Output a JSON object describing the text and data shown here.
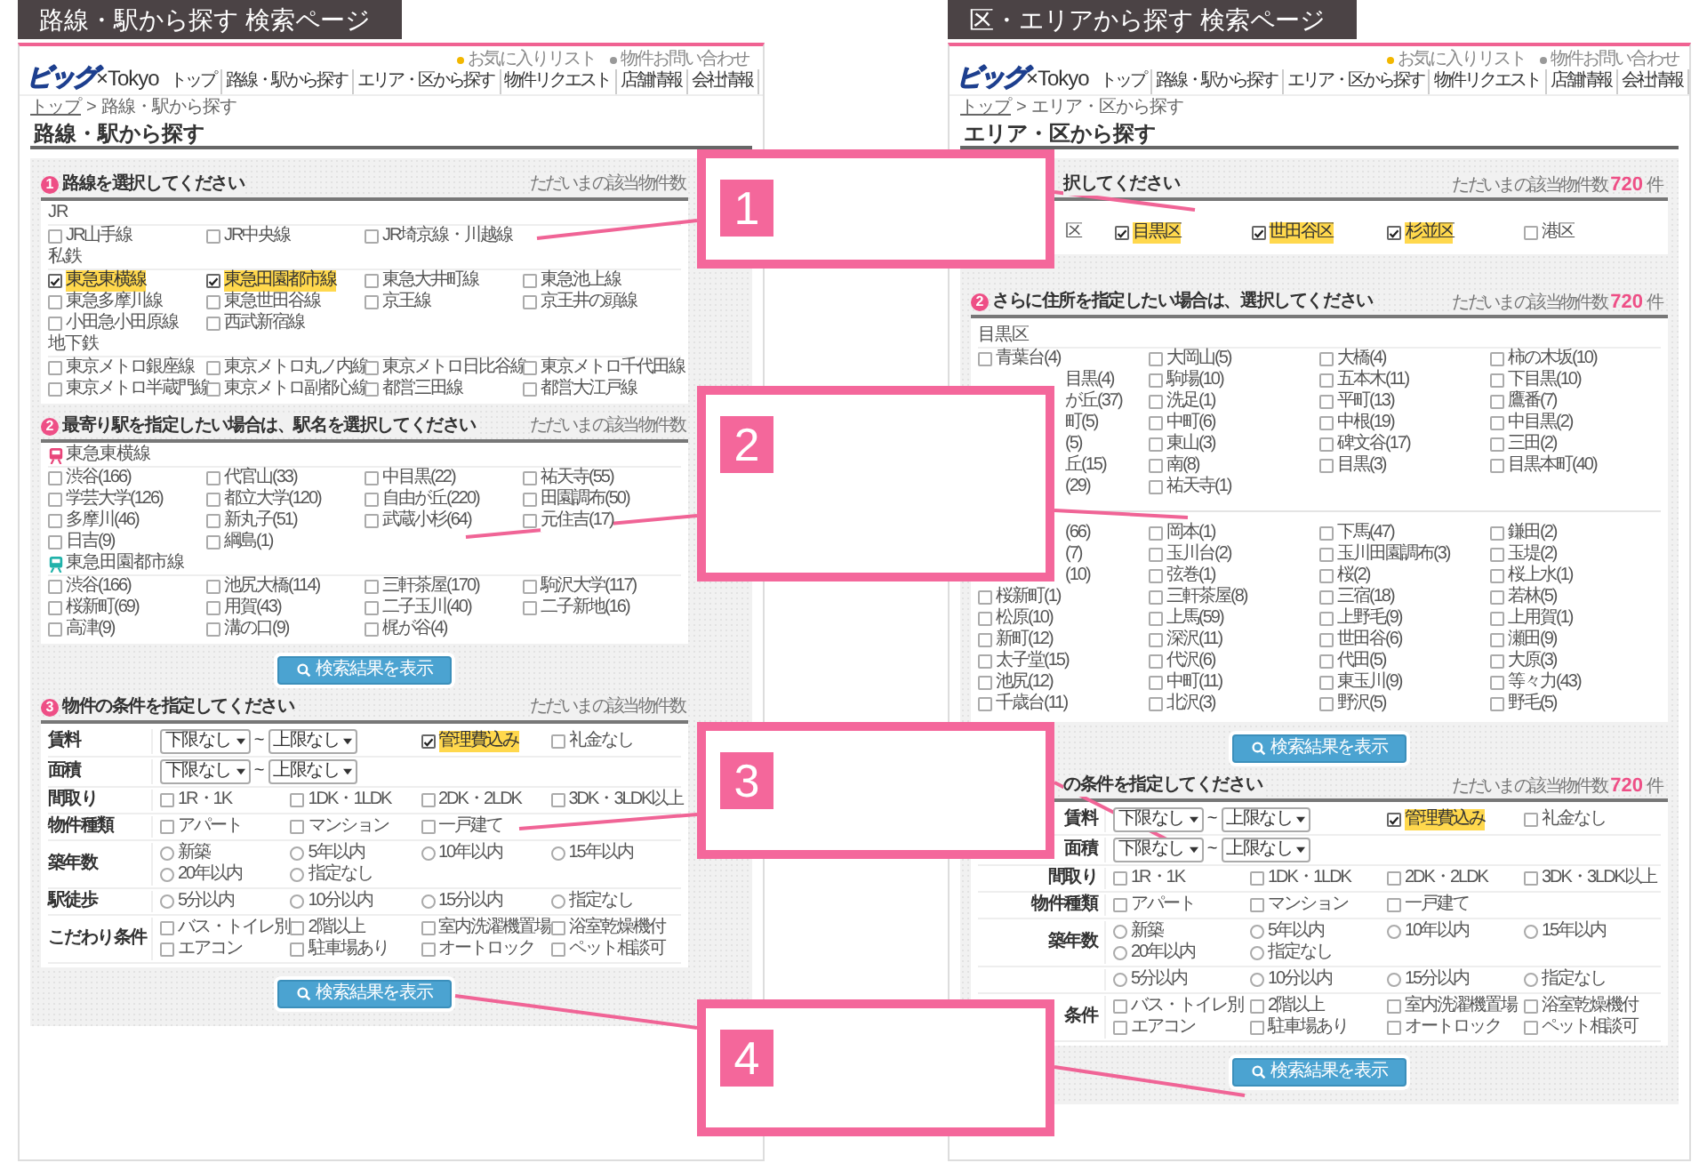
{
  "panels": [
    {
      "tab_title": "路線・駅から探す 検索ページ",
      "logo": {
        "mark": "ビッグ",
        "text": "×Tokyo"
      },
      "top_links": [
        "お気に入りリスト",
        "物件お問い合わせ"
      ],
      "nav": [
        "トップ",
        "路線・駅から探す",
        "エリア・区から探す",
        "物件リクエスト",
        "店舗情報",
        "会社情報"
      ],
      "breadcrumb": {
        "items": [
          "トップ",
          "路線・駅から探す"
        ],
        "separator": ">"
      },
      "heading": "路線・駅から探す",
      "sections": [
        {
          "kind": "checklist",
          "number": "1",
          "title": "路線を選択してください",
          "count_label": "ただいまの該当物件数",
          "groups": [
            {
              "label": "JR",
              "items": [
                {
                  "label": "JR山手線",
                  "checked": false
                },
                {
                  "label": "JR中央線",
                  "checked": false
                },
                {
                  "label": "JR埼京線・川越線",
                  "checked": false
                }
              ]
            },
            {
              "label": "私鉄",
              "items": [
                {
                  "label": "東急東横線",
                  "checked": true
                },
                {
                  "label": "東急田園都市線",
                  "checked": true
                },
                {
                  "label": "東急大井町線",
                  "checked": false
                },
                {
                  "label": "東急池上線",
                  "checked": false
                },
                {
                  "label": "東急多摩川線",
                  "checked": false
                },
                {
                  "label": "東急世田谷線",
                  "checked": false
                },
                {
                  "label": "京王線",
                  "checked": false
                },
                {
                  "label": "京王井の頭線",
                  "checked": false
                },
                {
                  "label": "小田急小田原線",
                  "checked": false
                },
                {
                  "label": "西武新宿線",
                  "checked": false
                }
              ]
            },
            {
              "label": "地下鉄",
              "items": [
                {
                  "label": "東京メトロ銀座線",
                  "checked": false
                },
                {
                  "label": "東京メトロ丸ノ内線",
                  "checked": false
                },
                {
                  "label": "東京メトロ日比谷線",
                  "checked": false
                },
                {
                  "label": "東京メトロ千代田線",
                  "checked": false
                },
                {
                  "label": "東京メトロ半蔵門線",
                  "checked": false
                },
                {
                  "label": "東京メトロ副都心線",
                  "checked": false
                },
                {
                  "label": "都営三田線",
                  "checked": false
                },
                {
                  "label": "都営大江戸線",
                  "checked": false
                }
              ]
            }
          ]
        },
        {
          "kind": "checklist",
          "number": "2",
          "title": "最寄り駅を指定したい場合は、駅名を選択してください",
          "count_label": "ただいまの該当物件数",
          "groups": [
            {
              "label": "東急東横線",
              "color": "#e8457a",
              "items": [
                {
                  "label": "渋谷(166)",
                  "checked": false
                },
                {
                  "label": "代官山(33)",
                  "checked": false
                },
                {
                  "label": "中目黒(22)",
                  "checked": false
                },
                {
                  "label": "祐天寺(55)",
                  "checked": false
                },
                {
                  "label": "学芸大学(126)",
                  "checked": false
                },
                {
                  "label": "都立大学(120)",
                  "checked": false
                },
                {
                  "label": "自由が丘(220)",
                  "checked": false
                },
                {
                  "label": "田園調布(50)",
                  "checked": false
                },
                {
                  "label": "多摩川(46)",
                  "checked": false
                },
                {
                  "label": "新丸子(51)",
                  "checked": false
                },
                {
                  "label": "武蔵小杉(64)",
                  "checked": false
                },
                {
                  "label": "元住吉(17)",
                  "checked": false
                },
                {
                  "label": "日吉(9)",
                  "checked": false
                },
                {
                  "label": "綱島(1)",
                  "checked": false
                }
              ]
            },
            {
              "label": "東急田園都市線",
              "color": "#20b2aa",
              "items": [
                {
                  "label": "渋谷(166)",
                  "checked": false
                },
                {
                  "label": "池尻大橋(114)",
                  "checked": false
                },
                {
                  "label": "三軒茶屋(170)",
                  "checked": false
                },
                {
                  "label": "駒沢大学(117)",
                  "checked": false
                },
                {
                  "label": "桜新町(69)",
                  "checked": false
                },
                {
                  "label": "用賀(43)",
                  "checked": false
                },
                {
                  "label": "二子玉川(40)",
                  "checked": false
                },
                {
                  "label": "二子新地(16)",
                  "checked": false
                },
                {
                  "label": "高津(9)",
                  "checked": false
                },
                {
                  "label": "溝の口(9)",
                  "checked": false
                },
                {
                  "label": "梶が谷(4)",
                  "checked": false
                }
              ]
            }
          ],
          "button": "検索結果を表示"
        },
        {
          "kind": "conditions",
          "number": "3",
          "title": "物件の条件を指定してください",
          "count_label": "ただいまの該当物件数",
          "rows": [
            {
              "label": "賃料",
              "cells": [
                {
                  "kind": "range",
                  "colspan": 2,
                  "from": "下限なし",
                  "separator": "~",
                  "to": "上限なし"
                },
                {
                  "kind": "checkbox",
                  "label": "管理費込み",
                  "checked": true
                },
                {
                  "kind": "checkbox",
                  "label": "礼金なし",
                  "checked": false
                }
              ]
            },
            {
              "label": "面積",
              "cells": [
                {
                  "kind": "range",
                  "colspan": 2,
                  "from": "下限なし",
                  "separator": "~",
                  "to": "上限なし"
                }
              ]
            },
            {
              "label": "間取り",
              "cells": [
                {
                  "kind": "checkbox",
                  "label": "1R・1K",
                  "checked": false
                },
                {
                  "kind": "checkbox",
                  "label": "1DK・1LDK",
                  "checked": false
                },
                {
                  "kind": "checkbox",
                  "label": "2DK・2LDK",
                  "checked": false
                },
                {
                  "kind": "checkbox",
                  "label": "3DK・3LDK以上",
                  "checked": false
                }
              ]
            },
            {
              "label": "物件種類",
              "cells": [
                {
                  "kind": "checkbox",
                  "label": "アパート",
                  "checked": false
                },
                {
                  "kind": "checkbox",
                  "label": "マンション",
                  "checked": false
                },
                {
                  "kind": "checkbox",
                  "label": "一戸建て",
                  "checked": false
                }
              ]
            },
            {
              "label": "築年数",
              "cells": [
                {
                  "kind": "radio",
                  "label": "新築",
                  "selected": false
                },
                {
                  "kind": "radio",
                  "label": "5年以内",
                  "selected": false
                },
                {
                  "kind": "radio",
                  "label": "10年以内",
                  "selected": false
                },
                {
                  "kind": "radio",
                  "label": "15年以内",
                  "selected": false
                },
                {
                  "kind": "radio",
                  "label": "20年以内",
                  "selected": false
                },
                {
                  "kind": "radio",
                  "label": "指定なし",
                  "selected": false
                }
              ]
            },
            {
              "label": "駅徒歩",
              "cells": [
                {
                  "kind": "radio",
                  "label": "5分以内",
                  "selected": false
                },
                {
                  "kind": "radio",
                  "label": "10分以内",
                  "selected": false
                },
                {
                  "kind": "radio",
                  "label": "15分以内",
                  "selected": false
                },
                {
                  "kind": "radio",
                  "label": "指定なし",
                  "selected": false
                }
              ]
            },
            {
              "label": "こだわり条件",
              "cells": [
                {
                  "kind": "checkbox",
                  "label": "バス・トイレ別",
                  "checked": false
                },
                {
                  "kind": "checkbox",
                  "label": "2階以上",
                  "checked": false
                },
                {
                  "kind": "checkbox",
                  "label": "室内洗濯機置場",
                  "checked": false
                },
                {
                  "kind": "checkbox",
                  "label": "浴室乾燥機付",
                  "checked": false
                },
                {
                  "kind": "checkbox",
                  "label": "エアコン",
                  "checked": false
                },
                {
                  "kind": "checkbox",
                  "label": "駐車場あり",
                  "checked": false
                },
                {
                  "kind": "checkbox",
                  "label": "オートロック",
                  "checked": false
                },
                {
                  "kind": "checkbox",
                  "label": "ペット相談可",
                  "checked": false
                }
              ]
            }
          ],
          "button": "検索結果を表示"
        }
      ]
    },
    {
      "tab_title": "区・エリアから探す 検索ページ",
      "logo": {
        "mark": "ビッグ",
        "text": "×Tokyo"
      },
      "top_links": [
        "お気に入りリスト",
        "物件お問い合わせ"
      ],
      "nav": [
        "トップ",
        "路線・駅から探す",
        "エリア・区から探す",
        "物件リクエスト",
        "店舗情報",
        "会社情報"
      ],
      "breadcrumb": {
        "items": [
          "トップ",
          "エリア・区から探す"
        ],
        "separator": ">"
      },
      "heading": "エリア・区から探す",
      "sections": [
        {
          "kind": "checklist",
          "title": "択してください",
          "count_label": "ただいまの該当物件数",
          "count": "720",
          "count_unit": "件",
          "groups": [
            {
              "items": [
                {
                  "kind": "partial",
                  "label": "区"
                },
                {
                  "label": "目黒区",
                  "checked": true
                },
                {
                  "label": "世田谷区",
                  "checked": true
                },
                {
                  "label": "杉並区",
                  "checked": true
                },
                {
                  "label": "港区",
                  "checked": false
                }
              ]
            }
          ]
        },
        {
          "kind": "checklist",
          "number": "2",
          "title": "さらに住所を指定したい場合は、選択してください",
          "count_label": "ただいまの該当物件数",
          "count": "720",
          "count_unit": "件",
          "groups": [
            {
              "label": "目黒区",
              "items": [
                {
                  "label": "青葉台(4)",
                  "checked": false
                },
                {
                  "label": "大岡山(5)",
                  "checked": false
                },
                {
                  "label": "大橋(4)",
                  "checked": false
                },
                {
                  "label": "柿の木坂(10)",
                  "checked": false
                },
                {
                  "kind": "partial",
                  "label": "目黒(4)"
                },
                {
                  "label": "駒場(10)",
                  "checked": false
                },
                {
                  "label": "五本木(11)",
                  "checked": false
                },
                {
                  "label": "下目黒(10)",
                  "checked": false
                },
                {
                  "kind": "partial",
                  "label": "が丘(37)"
                },
                {
                  "label": "洗足(1)",
                  "checked": false
                },
                {
                  "label": "平町(13)",
                  "checked": false
                },
                {
                  "label": "鷹番(7)",
                  "checked": false
                },
                {
                  "kind": "partial",
                  "label": "町(5)"
                },
                {
                  "label": "中町(6)",
                  "checked": false
                },
                {
                  "label": "中根(19)",
                  "checked": false
                },
                {
                  "label": "中目黒(2)",
                  "checked": false
                },
                {
                  "kind": "partial",
                  "label": "(5)"
                },
                {
                  "label": "東山(3)",
                  "checked": false
                },
                {
                  "label": "碑文谷(17)",
                  "checked": false
                },
                {
                  "label": "三田(2)",
                  "checked": false
                },
                {
                  "kind": "partial",
                  "label": "丘(15)"
                },
                {
                  "label": "南(8)",
                  "checked": false
                },
                {
                  "label": "目黒(3)",
                  "checked": false
                },
                {
                  "label": "目黒本町(40)",
                  "checked": false
                },
                {
                  "kind": "partial",
                  "label": "(29)"
                },
                {
                  "label": "祐天寺(1)",
                  "checked": false
                }
              ]
            },
            {
              "items": [
                {
                  "kind": "partial",
                  "label": "(66)"
                },
                {
                  "label": "岡本(1)",
                  "checked": false
                },
                {
                  "label": "下馬(47)",
                  "checked": false
                },
                {
                  "label": "鎌田(2)",
                  "checked": false
                },
                {
                  "kind": "partial",
                  "label": "(7)"
                },
                {
                  "label": "玉川台(2)",
                  "checked": false
                },
                {
                  "label": "玉川田園調布(3)",
                  "checked": false
                },
                {
                  "label": "玉堤(2)",
                  "checked": false
                },
                {
                  "kind": "partial",
                  "label": "(10)"
                },
                {
                  "label": "弦巻(1)",
                  "checked": false
                },
                {
                  "label": "桜(2)",
                  "checked": false
                },
                {
                  "label": "桜上水(1)",
                  "checked": false
                },
                {
                  "label": "桜新町(1)",
                  "checked": false
                },
                {
                  "label": "三軒茶屋(8)",
                  "checked": false
                },
                {
                  "label": "三宿(18)",
                  "checked": false
                },
                {
                  "label": "若林(5)",
                  "checked": false
                },
                {
                  "label": "松原(10)",
                  "checked": false
                },
                {
                  "label": "上馬(59)",
                  "checked": false
                },
                {
                  "label": "上野毛(9)",
                  "checked": false
                },
                {
                  "label": "上用賀(1)",
                  "checked": false
                },
                {
                  "label": "新町(12)",
                  "checked": false
                },
                {
                  "label": "深沢(11)",
                  "checked": false
                },
                {
                  "label": "世田谷(6)",
                  "checked": false
                },
                {
                  "label": "瀬田(9)",
                  "checked": false
                },
                {
                  "label": "太子堂(15)",
                  "checked": false
                },
                {
                  "label": "代沢(6)",
                  "checked": false
                },
                {
                  "label": "代田(5)",
                  "checked": false
                },
                {
                  "label": "大原(3)",
                  "checked": false
                },
                {
                  "label": "池尻(12)",
                  "checked": false
                },
                {
                  "label": "中町(11)",
                  "checked": false
                },
                {
                  "label": "東玉川(9)",
                  "checked": false
                },
                {
                  "label": "等々力(43)",
                  "checked": false
                },
                {
                  "label": "千歳台(11)",
                  "checked": false
                },
                {
                  "label": "北沢(3)",
                  "checked": false
                },
                {
                  "label": "野沢(5)",
                  "checked": false
                },
                {
                  "label": "野毛(5)",
                  "checked": false
                }
              ]
            }
          ],
          "button": "検索結果を表示"
        },
        {
          "kind": "conditions",
          "title": "の条件を指定してください",
          "count_label": "ただいまの該当物件数",
          "count": "720",
          "count_unit": "件",
          "rows": [
            {
              "label": "賃料",
              "cells": [
                {
                  "kind": "range",
                  "colspan": 2,
                  "from": "下限なし",
                  "separator": "~",
                  "to": "上限なし"
                },
                {
                  "kind": "checkbox",
                  "label": "管理費込み",
                  "checked": true
                },
                {
                  "kind": "checkbox",
                  "label": "礼金なし",
                  "checked": false
                }
              ]
            },
            {
              "label": "面積",
              "cells": [
                {
                  "kind": "range",
                  "colspan": 2,
                  "from": "下限なし",
                  "separator": "~",
                  "to": "上限なし"
                }
              ]
            },
            {
              "label": "間取り",
              "cells": [
                {
                  "kind": "checkbox",
                  "label": "1R・1K",
                  "checked": false
                },
                {
                  "kind": "checkbox",
                  "label": "1DK・1LDK",
                  "checked": false
                },
                {
                  "kind": "checkbox",
                  "label": "2DK・2LDK",
                  "checked": false
                },
                {
                  "kind": "checkbox",
                  "label": "3DK・3LDK以上",
                  "checked": false
                }
              ]
            },
            {
              "label": "物件種類",
              "cells": [
                {
                  "kind": "checkbox",
                  "label": "アパート",
                  "checked": false
                },
                {
                  "kind": "checkbox",
                  "label": "マンション",
                  "checked": false
                },
                {
                  "kind": "checkbox",
                  "label": "一戸建て",
                  "checked": false
                }
              ]
            },
            {
              "label": "築年数",
              "cells": [
                {
                  "kind": "radio",
                  "label": "新築",
                  "selected": false
                },
                {
                  "kind": "radio",
                  "label": "5年以内",
                  "selected": false
                },
                {
                  "kind": "radio",
                  "label": "10年以内",
                  "selected": false
                },
                {
                  "kind": "radio",
                  "label": "15年以内",
                  "selected": false
                },
                {
                  "kind": "radio",
                  "label": "20年以内",
                  "selected": false
                },
                {
                  "kind": "radio",
                  "label": "指定なし",
                  "selected": false
                }
              ]
            },
            {
              "cells": [
                {
                  "kind": "radio",
                  "label": "5分以内",
                  "selected": false
                },
                {
                  "kind": "radio",
                  "label": "10分以内",
                  "selected": false
                },
                {
                  "kind": "radio",
                  "label": "15分以内",
                  "selected": false
                },
                {
                  "kind": "radio",
                  "label": "指定なし",
                  "selected": false
                }
              ]
            },
            {
              "label": "条件",
              "cells": [
                {
                  "kind": "checkbox",
                  "label": "バス・トイレ別",
                  "checked": false
                },
                {
                  "kind": "checkbox",
                  "label": "2階以上",
                  "checked": false
                },
                {
                  "kind": "checkbox",
                  "label": "室内洗濯機置場",
                  "checked": false
                },
                {
                  "kind": "checkbox",
                  "label": "浴室乾燥機付",
                  "checked": false
                },
                {
                  "kind": "checkbox",
                  "label": "エアコン",
                  "checked": false
                },
                {
                  "kind": "checkbox",
                  "label": "駐車場あり",
                  "checked": false
                },
                {
                  "kind": "checkbox",
                  "label": "オートロック",
                  "checked": false
                },
                {
                  "kind": "checkbox",
                  "label": "ペット相談可",
                  "checked": false
                }
              ]
            }
          ],
          "button": "検索結果を表示"
        }
      ]
    }
  ],
  "callouts": [
    {
      "number": "1"
    },
    {
      "number": "2"
    },
    {
      "number": "3"
    },
    {
      "number": "4"
    }
  ]
}
